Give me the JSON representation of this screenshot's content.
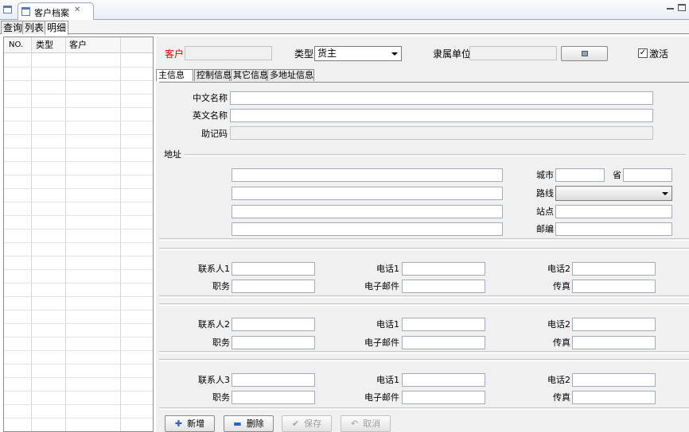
{
  "window": {
    "editor_tab_title": "客户档案",
    "close_glyph": "✕"
  },
  "subtabs": [
    "查询",
    "列表",
    "明细"
  ],
  "grid": {
    "headers": [
      "NO.",
      "类型",
      "客户"
    ]
  },
  "header": {
    "customer_label": "客户",
    "customer_value": "",
    "type_label": "类型",
    "type_value": "货主",
    "affiliation_label": "隶属单位",
    "affiliation_value": "",
    "active_label": "激活",
    "active_checked": true
  },
  "inner_tabs": [
    "主信息",
    "控制信息",
    "其它信息",
    "多地址信息"
  ],
  "main": {
    "cn_name_label": "中文名称",
    "en_name_label": "英文名称",
    "mnemonic_label": "助记码",
    "address_section_label": "地址",
    "city_label": "城市",
    "province_label": "省",
    "route_label": "路线",
    "station_label": "站点",
    "postcode_label": "邮编"
  },
  "contacts": [
    {
      "contact_label": "联系人1",
      "phone1_label": "电话1",
      "phone2_label": "电话2",
      "title_label": "职务",
      "email_label": "电子邮件",
      "fax_label": "传真"
    },
    {
      "contact_label": "联系人2",
      "phone1_label": "电话1",
      "phone2_label": "电话2",
      "title_label": "职务",
      "email_label": "电子邮件",
      "fax_label": "传真"
    },
    {
      "contact_label": "联系人3",
      "phone1_label": "电话1",
      "phone2_label": "电话2",
      "title_label": "职务",
      "email_label": "电子邮件",
      "fax_label": "传真"
    }
  ],
  "buttons": {
    "add": "新增",
    "delete": "删除",
    "save": "保存",
    "cancel": "取消"
  },
  "colors": {
    "customer_label": "#e00000",
    "add_icon": "#3060c0",
    "delete_icon": "#3060c0"
  }
}
